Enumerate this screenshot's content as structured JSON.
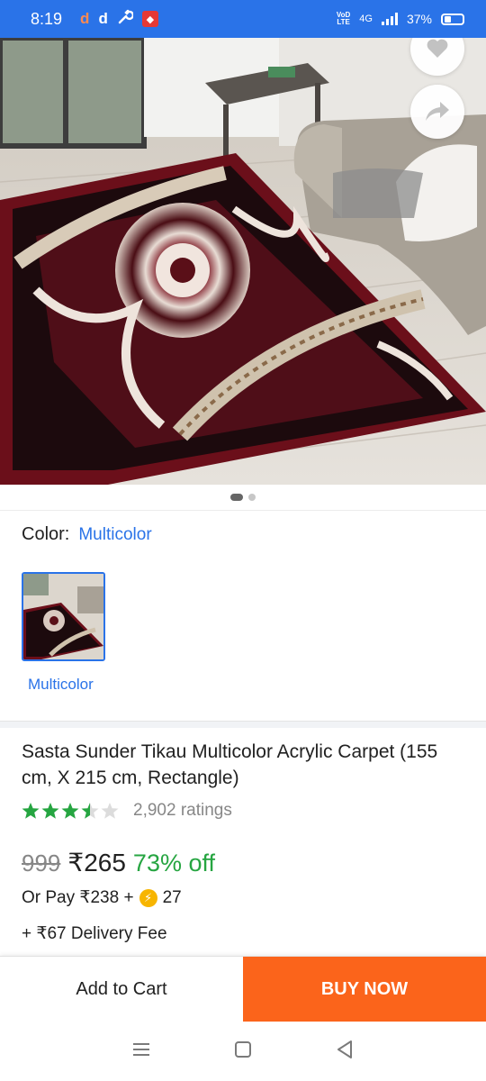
{
  "status_bar": {
    "time": "8:19",
    "notif_1": "d",
    "notif_2": "d",
    "volte_top": "VoD",
    "volte_bottom": "LTE",
    "network": "4G",
    "battery": "37%"
  },
  "gallery": {
    "slide_count": 2,
    "active_slide": 1
  },
  "color_selector": {
    "label": "Color:",
    "selected": "Multicolor",
    "options": [
      {
        "label": "Multicolor"
      }
    ]
  },
  "product": {
    "title": "Sasta Sunder Tikau Multicolor Acrylic Carpet (155 cm,  X 215 cm, Rectangle)",
    "rating_value": 3.5,
    "ratings_text": "2,902 ratings",
    "mrp": "999",
    "price": "₹265",
    "discount": "73% off",
    "pay_prefix": "Or Pay ₹238 +",
    "coins": "27",
    "delivery": "+ ₹67 Delivery Fee"
  },
  "actions": {
    "add_to_cart": "Add to Cart",
    "buy_now": "BUY NOW"
  },
  "colors": {
    "accent": "#2a73e8",
    "buy_now": "#fb641b",
    "discount_green": "#26a541",
    "star_green": "#26a541"
  },
  "icons": [
    "wishlist-heart-icon",
    "share-icon",
    "supercoin-icon",
    "menu-icon",
    "home-icon",
    "back-icon"
  ]
}
